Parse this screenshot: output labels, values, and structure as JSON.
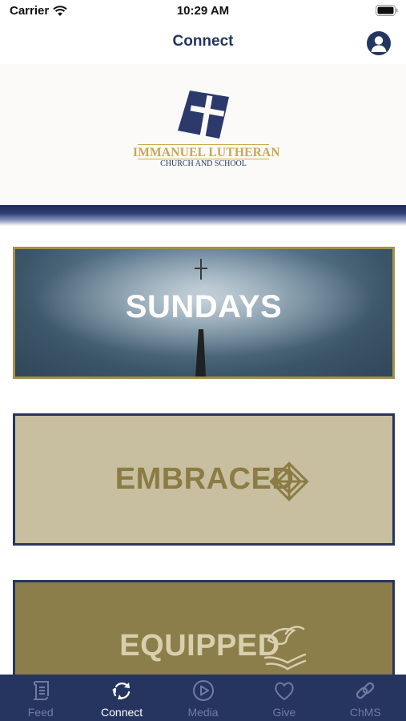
{
  "status_bar": {
    "carrier": "Carrier",
    "time": "10:29 AM"
  },
  "nav": {
    "title": "Connect",
    "profile_icon": "user-icon"
  },
  "logo": {
    "name_line": "IMMANUEL LUTHERAN",
    "sub_line": "CHURCH AND SCHOOL",
    "icon": "cross-icon",
    "colors": {
      "gold": "#c9a84a",
      "navy": "#233561"
    }
  },
  "cards": [
    {
      "label": "SUNDAYS",
      "border": "#a4904a"
    },
    {
      "label": "EMBRACED",
      "icon": "interlocked-square-icon",
      "border": "#263560"
    },
    {
      "label": "EQUIPPED",
      "icon": "dove-hands-icon",
      "border": "#263560"
    }
  ],
  "tabs": [
    {
      "label": "Feed",
      "icon": "scroll-icon",
      "active": false
    },
    {
      "label": "Connect",
      "icon": "refresh-cycle-icon",
      "active": true
    },
    {
      "label": "Media",
      "icon": "play-circle-icon",
      "active": false
    },
    {
      "label": "Give",
      "icon": "heart-icon",
      "active": false
    },
    {
      "label": "ChMS",
      "icon": "link-icon",
      "active": false
    }
  ],
  "colors": {
    "brand_navy": "#263560",
    "gold": "#a4904a",
    "tab_inactive": "#6f7ca0",
    "tab_active": "#ffffff"
  }
}
